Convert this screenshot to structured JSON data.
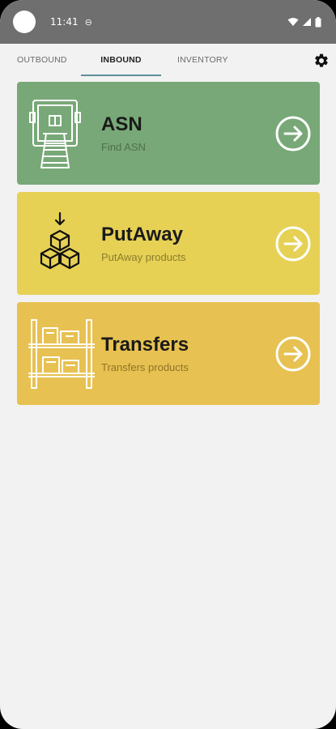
{
  "status_bar": {
    "time": "11:41",
    "sim_icon": "sim-card-icon",
    "icons": [
      "wifi-icon",
      "signal-icon",
      "battery-icon"
    ]
  },
  "tabs": [
    {
      "label": "OUTBOUND",
      "active": false
    },
    {
      "label": "INBOUND",
      "active": true
    },
    {
      "label": "INVENTORY",
      "active": false
    }
  ],
  "settings_icon": "gear-icon",
  "colors": {
    "accent": "#5f8f97",
    "asn": "#78a877",
    "putaway": "#e6d155",
    "transfers": "#e7c151"
  },
  "cards": [
    {
      "title": "ASN",
      "subtitle": "Find ASN",
      "icon": "truck-unloading-icon"
    },
    {
      "title": "PutAway",
      "subtitle": "PutAway products",
      "icon": "stacked-boxes-icon"
    },
    {
      "title": "Transfers",
      "subtitle": "Transfers products",
      "icon": "warehouse-shelves-icon"
    }
  ]
}
